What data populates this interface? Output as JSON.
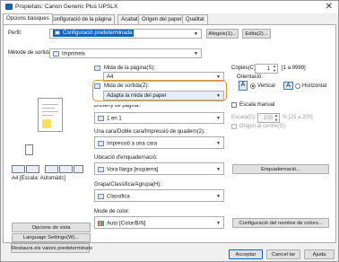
{
  "title": "Propietats: Canon Generic Plus UPSLX",
  "tabs": [
    "Opcions bàsiques",
    "Configuració de la pàgina",
    "Acabat",
    "Origen del paper",
    "Qualitat"
  ],
  "profile": {
    "label": "Perfil:",
    "value": "Configuració predeterminada",
    "add": "Afegeix(1)...",
    "edit": "Edita(2)..."
  },
  "output": {
    "label": "Mètode de sortida:",
    "value": "Imprimeix"
  },
  "page_size": {
    "label": "Mida de la pàgina(S):",
    "value": "A4"
  },
  "output_size": {
    "label": "Mida de sortida(Z):",
    "value": "Adapta la mida del paper"
  },
  "copies": {
    "label": "Còpies(C):",
    "value": "1",
    "range": "[1 a 9999]"
  },
  "orientation": {
    "label": "Orientació:",
    "vertical": "Vertical",
    "horizontal": "Horizontal"
  },
  "layout": {
    "label": "Disseny de pàgina:",
    "value": "1 en 1"
  },
  "manual_scale": {
    "label": "Escala manual",
    "scale_label": "Escala(E):",
    "scale_value": "100",
    "scale_range": "% [25 a 200]",
    "centre": "Origen al centre(S)"
  },
  "duplex": {
    "label": "Una cara/Doble cara/Impressió de quadern(2):",
    "value": "Impressió a una cara"
  },
  "binding": {
    "label": "Ubicació d'enquadernació:",
    "value": "Vora llarga [esquerra]",
    "button": "Enquadernació..."
  },
  "staple": {
    "label": "Grapa/Classifica/Agrupa(H):",
    "value": "Classifica"
  },
  "colour": {
    "label": "Mode de color:",
    "value": "Auto [Color/B/N]",
    "button": "Configuració del nombre de colors..."
  },
  "preview_caption": "A4 [Escala: Automàtic]",
  "left_buttons": [
    "Opcions de vista",
    "Language Settings(W)...",
    "Restaura els valors predeterminats"
  ],
  "footer": {
    "ok": "Acceptar",
    "cancel": "Cancel·lar",
    "help": "Ajuda"
  }
}
